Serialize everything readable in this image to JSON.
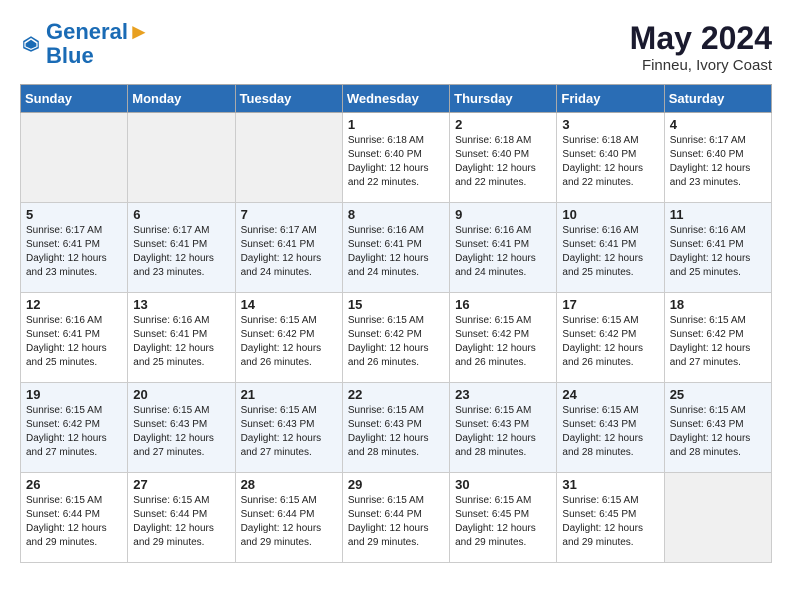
{
  "logo": {
    "line1": "General",
    "line2": "Blue"
  },
  "title": "May 2024",
  "location": "Finneu, Ivory Coast",
  "days_of_week": [
    "Sunday",
    "Monday",
    "Tuesday",
    "Wednesday",
    "Thursday",
    "Friday",
    "Saturday"
  ],
  "weeks": [
    [
      {
        "day": "",
        "empty": true
      },
      {
        "day": "",
        "empty": true
      },
      {
        "day": "",
        "empty": true
      },
      {
        "day": "1",
        "sunrise": "6:18 AM",
        "sunset": "6:40 PM",
        "daylight": "12 hours and 22 minutes."
      },
      {
        "day": "2",
        "sunrise": "6:18 AM",
        "sunset": "6:40 PM",
        "daylight": "12 hours and 22 minutes."
      },
      {
        "day": "3",
        "sunrise": "6:18 AM",
        "sunset": "6:40 PM",
        "daylight": "12 hours and 22 minutes."
      },
      {
        "day": "4",
        "sunrise": "6:17 AM",
        "sunset": "6:40 PM",
        "daylight": "12 hours and 23 minutes."
      }
    ],
    [
      {
        "day": "5",
        "sunrise": "6:17 AM",
        "sunset": "6:41 PM",
        "daylight": "12 hours and 23 minutes."
      },
      {
        "day": "6",
        "sunrise": "6:17 AM",
        "sunset": "6:41 PM",
        "daylight": "12 hours and 23 minutes."
      },
      {
        "day": "7",
        "sunrise": "6:17 AM",
        "sunset": "6:41 PM",
        "daylight": "12 hours and 24 minutes."
      },
      {
        "day": "8",
        "sunrise": "6:16 AM",
        "sunset": "6:41 PM",
        "daylight": "12 hours and 24 minutes."
      },
      {
        "day": "9",
        "sunrise": "6:16 AM",
        "sunset": "6:41 PM",
        "daylight": "12 hours and 24 minutes."
      },
      {
        "day": "10",
        "sunrise": "6:16 AM",
        "sunset": "6:41 PM",
        "daylight": "12 hours and 25 minutes."
      },
      {
        "day": "11",
        "sunrise": "6:16 AM",
        "sunset": "6:41 PM",
        "daylight": "12 hours and 25 minutes."
      }
    ],
    [
      {
        "day": "12",
        "sunrise": "6:16 AM",
        "sunset": "6:41 PM",
        "daylight": "12 hours and 25 minutes."
      },
      {
        "day": "13",
        "sunrise": "6:16 AM",
        "sunset": "6:41 PM",
        "daylight": "12 hours and 25 minutes."
      },
      {
        "day": "14",
        "sunrise": "6:15 AM",
        "sunset": "6:42 PM",
        "daylight": "12 hours and 26 minutes."
      },
      {
        "day": "15",
        "sunrise": "6:15 AM",
        "sunset": "6:42 PM",
        "daylight": "12 hours and 26 minutes."
      },
      {
        "day": "16",
        "sunrise": "6:15 AM",
        "sunset": "6:42 PM",
        "daylight": "12 hours and 26 minutes."
      },
      {
        "day": "17",
        "sunrise": "6:15 AM",
        "sunset": "6:42 PM",
        "daylight": "12 hours and 26 minutes."
      },
      {
        "day": "18",
        "sunrise": "6:15 AM",
        "sunset": "6:42 PM",
        "daylight": "12 hours and 27 minutes."
      }
    ],
    [
      {
        "day": "19",
        "sunrise": "6:15 AM",
        "sunset": "6:42 PM",
        "daylight": "12 hours and 27 minutes."
      },
      {
        "day": "20",
        "sunrise": "6:15 AM",
        "sunset": "6:43 PM",
        "daylight": "12 hours and 27 minutes."
      },
      {
        "day": "21",
        "sunrise": "6:15 AM",
        "sunset": "6:43 PM",
        "daylight": "12 hours and 27 minutes."
      },
      {
        "day": "22",
        "sunrise": "6:15 AM",
        "sunset": "6:43 PM",
        "daylight": "12 hours and 28 minutes."
      },
      {
        "day": "23",
        "sunrise": "6:15 AM",
        "sunset": "6:43 PM",
        "daylight": "12 hours and 28 minutes."
      },
      {
        "day": "24",
        "sunrise": "6:15 AM",
        "sunset": "6:43 PM",
        "daylight": "12 hours and 28 minutes."
      },
      {
        "day": "25",
        "sunrise": "6:15 AM",
        "sunset": "6:43 PM",
        "daylight": "12 hours and 28 minutes."
      }
    ],
    [
      {
        "day": "26",
        "sunrise": "6:15 AM",
        "sunset": "6:44 PM",
        "daylight": "12 hours and 29 minutes."
      },
      {
        "day": "27",
        "sunrise": "6:15 AM",
        "sunset": "6:44 PM",
        "daylight": "12 hours and 29 minutes."
      },
      {
        "day": "28",
        "sunrise": "6:15 AM",
        "sunset": "6:44 PM",
        "daylight": "12 hours and 29 minutes."
      },
      {
        "day": "29",
        "sunrise": "6:15 AM",
        "sunset": "6:44 PM",
        "daylight": "12 hours and 29 minutes."
      },
      {
        "day": "30",
        "sunrise": "6:15 AM",
        "sunset": "6:45 PM",
        "daylight": "12 hours and 29 minutes."
      },
      {
        "day": "31",
        "sunrise": "6:15 AM",
        "sunset": "6:45 PM",
        "daylight": "12 hours and 29 minutes."
      },
      {
        "day": "",
        "empty": true
      }
    ]
  ]
}
